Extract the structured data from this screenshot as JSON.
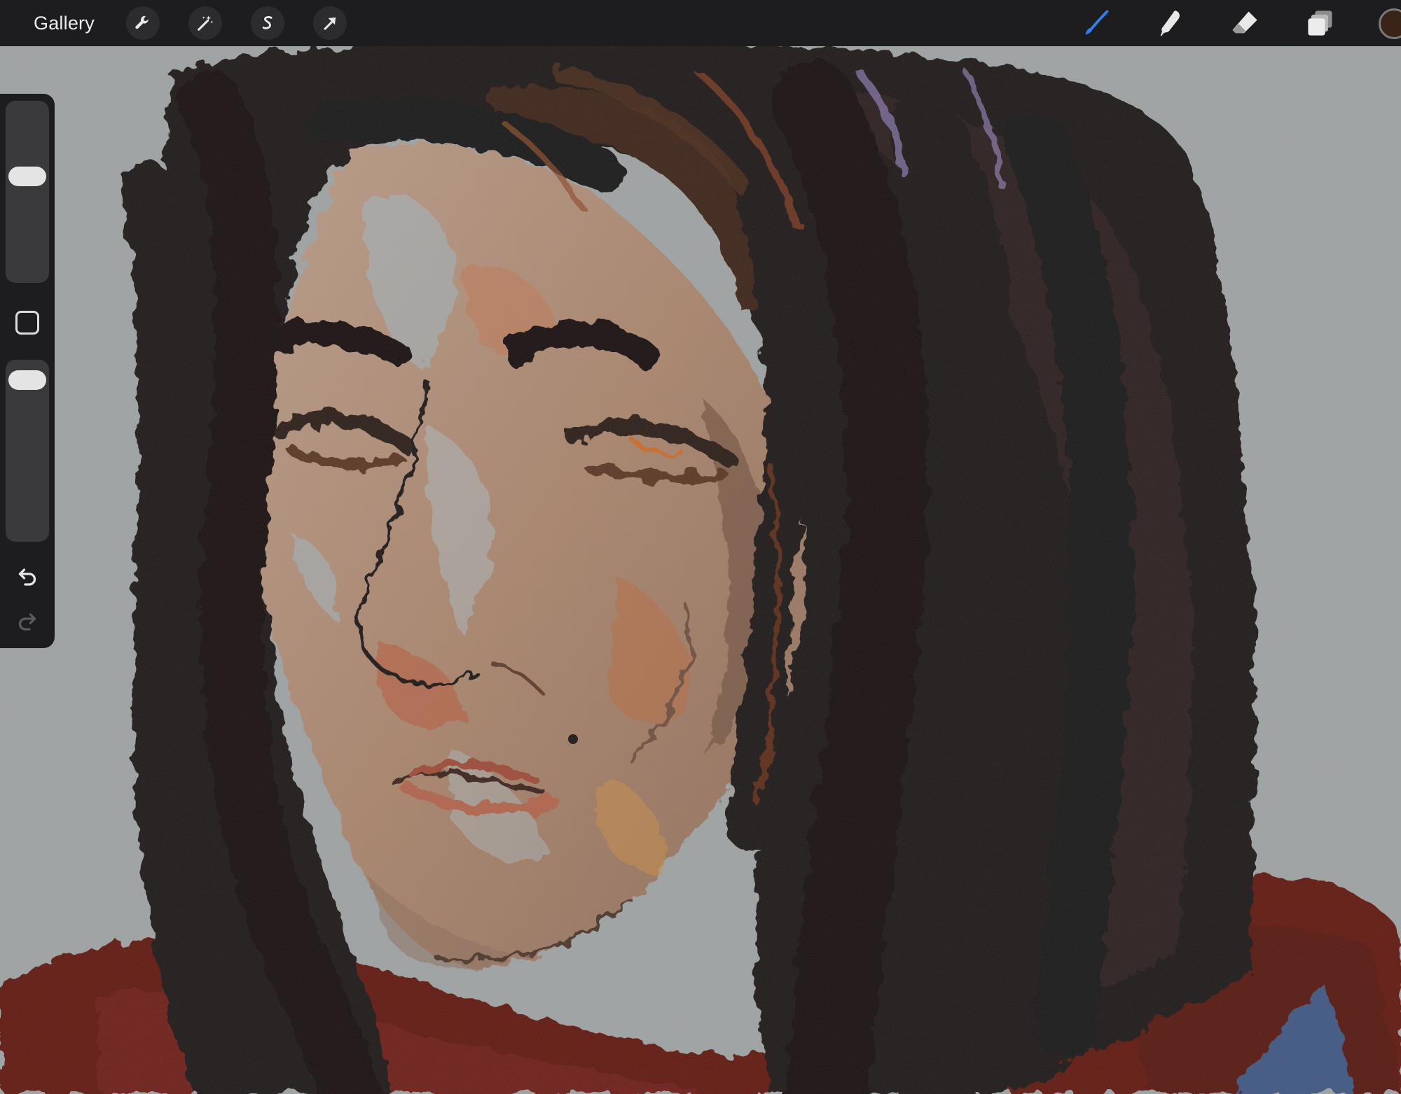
{
  "toolbar": {
    "gallery_label": "Gallery",
    "left_tools": [
      {
        "name": "actions",
        "icon": "wrench-icon"
      },
      {
        "name": "adjustments",
        "icon": "magic-wand-icon"
      },
      {
        "name": "selection",
        "icon": "selection-s-icon"
      },
      {
        "name": "transform",
        "icon": "arrow-cursor-icon"
      }
    ],
    "right_tools": [
      {
        "name": "brush",
        "icon": "brush-icon",
        "active": true
      },
      {
        "name": "smudge",
        "icon": "smudge-finger-icon",
        "active": false
      },
      {
        "name": "eraser",
        "icon": "eraser-icon",
        "active": false
      },
      {
        "name": "layers",
        "icon": "layers-icon",
        "active": false
      }
    ],
    "current_color": "#3a2418",
    "active_tool_color": "#2f7ff0"
  },
  "sidebar": {
    "brush_size": 0.6,
    "brush_opacity": 0.95,
    "modify_icon": "square-modify-icon",
    "undo_icon": "undo-icon",
    "redo_icon": "redo-icon"
  },
  "canvas": {
    "paper_color": "#9ea1a2",
    "skin_color": "#a8836b",
    "hair_color": "#1b1715",
    "sweater_color": "#5e1510",
    "accent_blue": "#3d5480"
  }
}
